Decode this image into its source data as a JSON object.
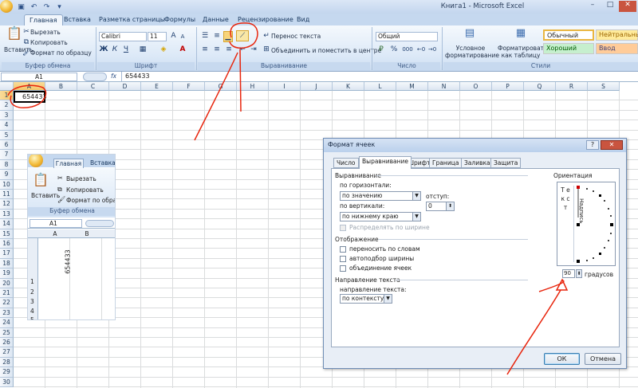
{
  "window": {
    "title": "Книга1 - Microsoft Excel",
    "minimize": "–",
    "maximize": "□",
    "close": "✕"
  },
  "tabs": [
    "Главная",
    "Вставка",
    "Разметка страницы",
    "Формулы",
    "Данные",
    "Рецензирование",
    "Вид"
  ],
  "clipboard": {
    "paste": "Вставить",
    "cut": "Вырезать",
    "copy": "Копировать",
    "format_painter": "Формат по образцу",
    "group": "Буфер обмена"
  },
  "font": {
    "name": "Calibri",
    "size": "11",
    "bold": "Ж",
    "italic": "К",
    "underline": "Ч",
    "group": "Шрифт"
  },
  "alignment": {
    "wrap": "Перенос текста",
    "merge": "Объединить и поместить в центре",
    "group": "Выравнивание"
  },
  "number": {
    "format": "Общий",
    "group": "Число",
    "percent": "%",
    "thousands": "000"
  },
  "styles": {
    "conditional": [
      "Условное",
      "форматирование"
    ],
    "format_table": [
      "Форматировать",
      "как таблицу"
    ],
    "normal": "Обычный",
    "neutral": "Нейтральный",
    "good": "Хороший",
    "input": "Ввод",
    "group": "Стили"
  },
  "formula_bar": {
    "name_box": "A1",
    "fx": "fx",
    "content": "654433"
  },
  "columns": [
    "A",
    "B",
    "C",
    "D",
    "E",
    "F",
    "G",
    "H",
    "I",
    "J",
    "K",
    "L",
    "M",
    "N",
    "O",
    "P",
    "Q",
    "R",
    "S"
  ],
  "rows": [
    "1",
    "2",
    "3",
    "4",
    "5",
    "6",
    "7",
    "8",
    "9",
    "10",
    "11",
    "12",
    "13",
    "14",
    "15",
    "16",
    "17",
    "18",
    "19",
    "20",
    "21",
    "22",
    "23",
    "24",
    "25",
    "26",
    "27",
    "28",
    "29",
    "30"
  ],
  "cell_a1": "654433",
  "inset": {
    "tabs": [
      "Главная",
      "Вставка"
    ],
    "paste": "Вставить",
    "cut": "Вырезать",
    "copy": "Копировать",
    "format_painter": "Формат по образцу",
    "group": "Буфер обмена",
    "name_box": "A1",
    "columns": [
      "A",
      "B"
    ],
    "rows": [
      "1",
      "2",
      "3",
      "4",
      "5"
    ],
    "cell_value": "654433"
  },
  "dialog": {
    "title": "Формат ячеек",
    "help": "?",
    "close": "✕",
    "tabs": [
      "Число",
      "Выравнивание",
      "Шрифт",
      "Граница",
      "Заливка",
      "Защита"
    ],
    "alignment_section": "Выравнивание",
    "horizontal_label": "по горизонтали:",
    "horizontal_value": "по значению",
    "indent_label": "отступ:",
    "indent_value": "0",
    "vertical_label": "по вертикали:",
    "vertical_value": "по нижнему краю",
    "distributed": "Распределять по ширине",
    "display_section": "Отображение",
    "wrap": "переносить по словам",
    "autofit": "автоподбор ширины",
    "merge": "объединение ячеек",
    "direction_section": "Направление текста",
    "direction_label": "направление текста:",
    "direction_value": "по контексту",
    "orientation_section": "Ориентация",
    "vertical_text": "Т е к с т",
    "rotated_text": "Надпись",
    "degrees_value": "90",
    "degrees_label": "градусов",
    "ok": "ОК",
    "cancel": "Отмена"
  },
  "colors": {
    "accent": "#1f4e8c",
    "annotation": "#e8250d",
    "ribbon": "#dbe8f7"
  }
}
